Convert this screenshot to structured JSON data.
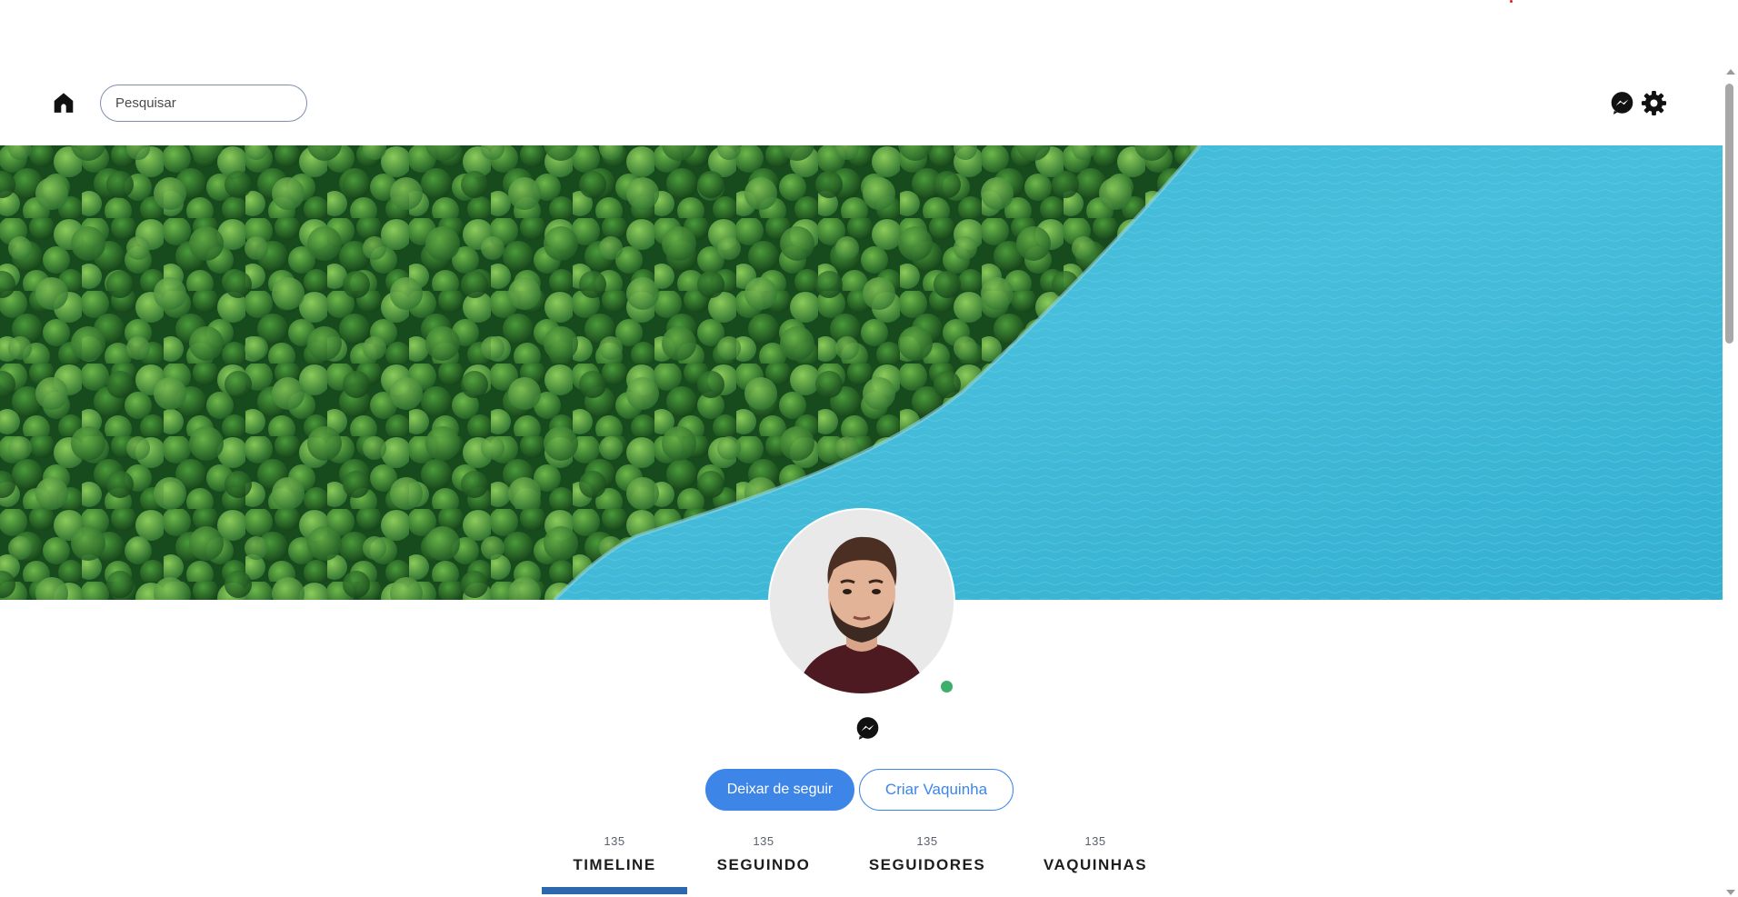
{
  "search": {
    "placeholder": "Pesquisar"
  },
  "icons": {
    "home": "home-icon",
    "messenger": "messenger-icon",
    "settings": "gear-icon"
  },
  "profile": {
    "status": "online",
    "status_color": "#3daf6a",
    "cover_image": "aerial view of a green forest meeting turquoise water",
    "avatar_image": "man with brown hair and beard wearing a dark red t-shirt"
  },
  "actions": {
    "unfollow_label": "Deixar de seguir",
    "create_fund_label": "Criar Vaquinha"
  },
  "tabs": [
    {
      "count": "135",
      "label": "TIMELINE",
      "active": true
    },
    {
      "count": "135",
      "label": "SEGUINDO",
      "active": false
    },
    {
      "count": "135",
      "label": "SEGUIDORES",
      "active": false
    },
    {
      "count": "135",
      "label": "VAQUINHAS",
      "active": false
    }
  ],
  "colors": {
    "primary": "#3d86e8",
    "active_tab_underline": "#2d67ad",
    "online": "#3daf6a"
  }
}
